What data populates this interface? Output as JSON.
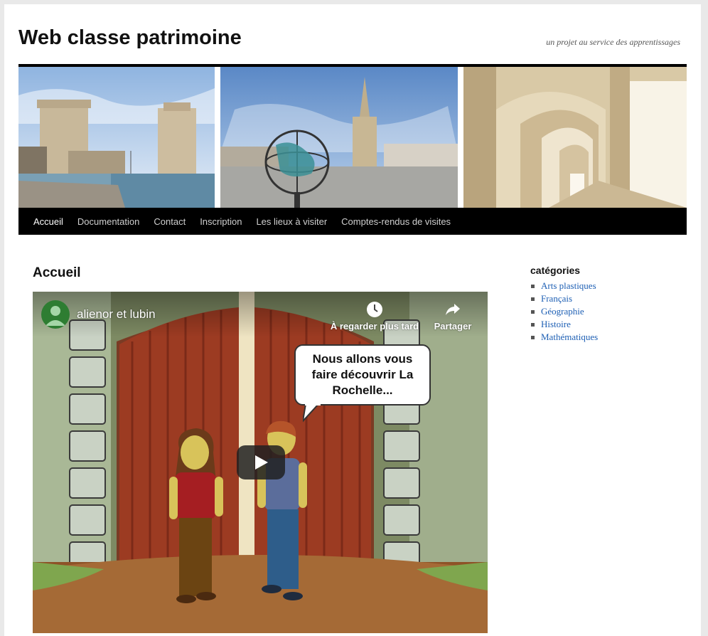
{
  "site": {
    "title": "Web classe patrimoine",
    "tagline": "un projet au service des apprentissages"
  },
  "nav": {
    "items": [
      {
        "label": "Accueil",
        "current": true
      },
      {
        "label": "Documentation"
      },
      {
        "label": "Contact"
      },
      {
        "label": "Inscription"
      },
      {
        "label": "Les lieux à visiter"
      },
      {
        "label": "Comptes-rendus de visites"
      }
    ]
  },
  "main": {
    "title": "Accueil"
  },
  "video": {
    "channel_title": "alienor et lubin",
    "watch_later": "À regarder plus tard",
    "share": "Partager",
    "bubble": [
      "Nous allons vous",
      "faire découvrir La",
      "Rochelle..."
    ]
  },
  "sidebar": {
    "heading": "catégories",
    "items": [
      "Arts plastiques",
      "Français",
      "Géographie",
      "Histoire",
      "Mathématiques"
    ]
  },
  "colors": {
    "nav_bg": "#000000",
    "link": "#1d5fb4",
    "youtube_play": "#212121"
  }
}
